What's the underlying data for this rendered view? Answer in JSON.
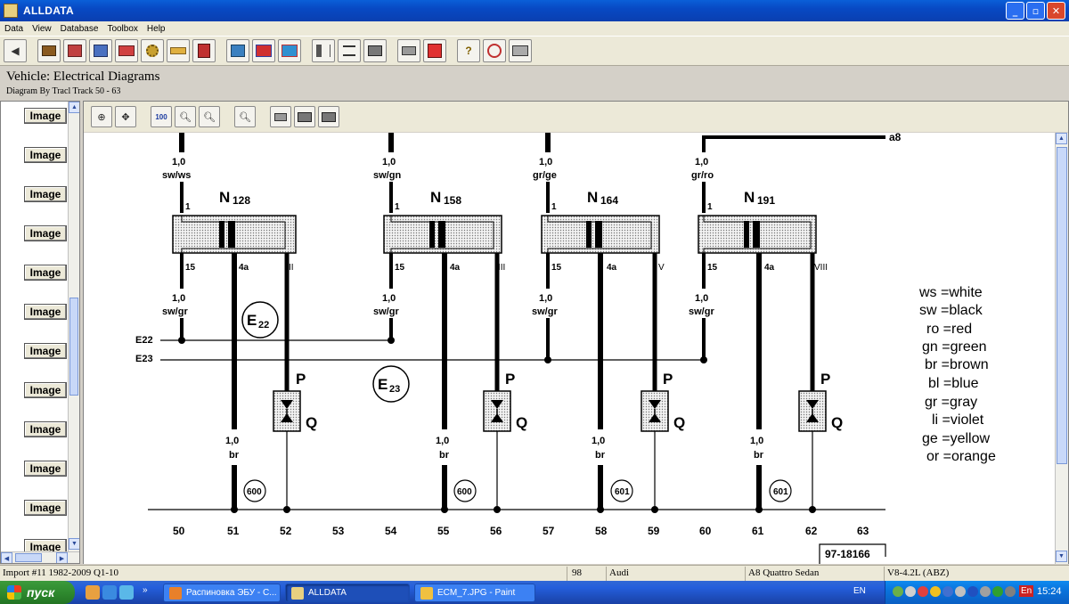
{
  "window": {
    "title": "ALLDATA",
    "minimize": "_",
    "maximize": "▫",
    "close": "✕"
  },
  "menu": [
    {
      "label": "Data"
    },
    {
      "label": "View"
    },
    {
      "label": "Database"
    },
    {
      "label": "Toolbox"
    },
    {
      "label": "Help"
    }
  ],
  "header": {
    "vehicle": "Vehicle:  Electrical Diagrams",
    "track": "Diagram By Tracl  Track 50 - 63"
  },
  "left_panel": {
    "image_label": "Image",
    "count": 12
  },
  "diagram": {
    "wires_top": [
      "1,0",
      "sw/ws",
      "1,0",
      "sw/gn",
      "1,0",
      "gr/ge",
      "1,0",
      "gr/ro"
    ],
    "components": [
      {
        "id": "N",
        "sub": "128",
        "roman": "II"
      },
      {
        "id": "N",
        "sub": "158",
        "roman": "III"
      },
      {
        "id": "N",
        "sub": "164",
        "roman": "V"
      },
      {
        "id": "N",
        "sub": "191",
        "roman": "VIII"
      }
    ],
    "pin_labels": {
      "p1": "1",
      "p15": "15",
      "p4a": "4a"
    },
    "wire_mid": {
      "size": "1,0",
      "color": "sw/gr"
    },
    "wire_low": {
      "size": "1,0",
      "color": "br"
    },
    "buses": [
      "E22",
      "E23"
    ],
    "bus_circles": [
      {
        "main": "E",
        "sub": "22"
      },
      {
        "main": "E",
        "sub": "23"
      }
    ],
    "pq": {
      "p": "P",
      "q": "Q"
    },
    "grounds": [
      "600",
      "600",
      "601",
      "601"
    ],
    "a8_label": "a8",
    "track_numbers": [
      "50",
      "51",
      "52",
      "53",
      "54",
      "55",
      "56",
      "57",
      "58",
      "59",
      "60",
      "61",
      "62",
      "63"
    ],
    "doc_id": "97-18166",
    "legend": [
      "ws =white",
      "sw =black",
      "ro =red",
      "gn =green",
      "br =brown",
      "bl =blue",
      "gr =gray",
      "li =violet",
      "ge =yellow",
      "or =orange"
    ]
  },
  "status": {
    "import": "Import #11 1982-2009 Q1-10",
    "num": "98",
    "make": "Audi",
    "model": "A8 Quattro Sedan",
    "engine": "V8-4.2L (ABZ)"
  },
  "taskbar": {
    "start": "пуск",
    "tasks": [
      {
        "label": "Распиновка ЭБУ - С..."
      },
      {
        "label": "ALLDATA"
      },
      {
        "label": "ECM_7.JPG - Paint"
      }
    ],
    "lang": "EN",
    "tray_lang": "En",
    "clock": "15:24"
  }
}
